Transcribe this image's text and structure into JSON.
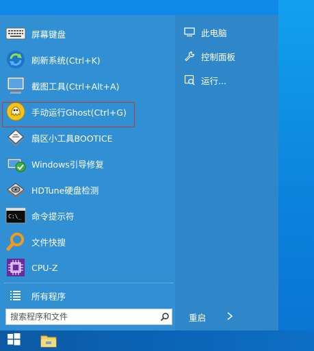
{
  "menu": {
    "items": [
      {
        "label": "屏幕键盘",
        "icon": "keyboard-icon"
      },
      {
        "label": "刷新系统(Ctrl+K)",
        "icon": "refresh-icon"
      },
      {
        "label": "截图工具(Ctrl+Alt+A)",
        "icon": "screenshot-icon"
      },
      {
        "label": "手动运行Ghost(Ctrl+G)",
        "icon": "ghost-icon"
      },
      {
        "label": "扇区小工具BOOTICE",
        "icon": "bootice-icon"
      },
      {
        "label": "Windows引导修复",
        "icon": "boot-repair-icon"
      },
      {
        "label": "HDTune硬盘检测",
        "icon": "hdtune-icon"
      },
      {
        "label": "命令提示符",
        "icon": "cmd-icon"
      },
      {
        "label": "文件快搜",
        "icon": "file-search-icon"
      },
      {
        "label": "CPU-Z",
        "icon": "cpuz-icon"
      }
    ],
    "all_programs": "所有程序"
  },
  "right": {
    "items": [
      {
        "label": "此电脑",
        "icon": "computer-icon"
      },
      {
        "label": "控制面板",
        "icon": "control-panel-icon"
      },
      {
        "label": "运行...",
        "icon": "run-icon"
      }
    ],
    "restart": "重启"
  },
  "search": {
    "placeholder": "搜索程序和文件"
  },
  "colors": {
    "menu_bg": "#3090d3",
    "highlight_border": "#c0393b",
    "taskbar": "#0b63b6"
  }
}
